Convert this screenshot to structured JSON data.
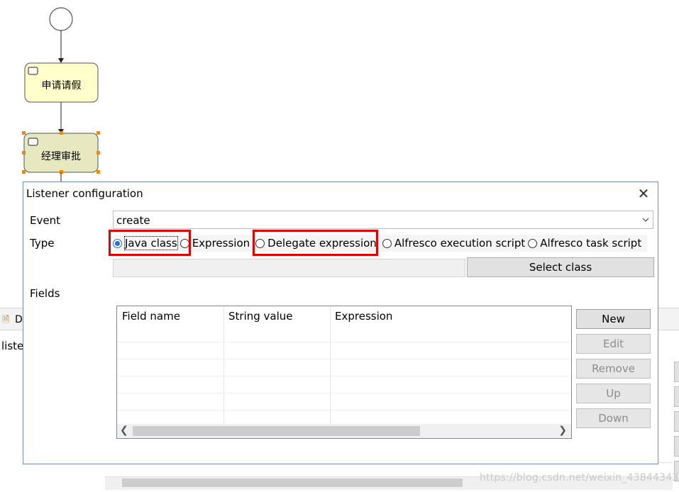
{
  "diagram": {
    "tasks": [
      {
        "label": "申请请假"
      },
      {
        "label": "经理审批"
      }
    ]
  },
  "background": {
    "tab_text": "D",
    "list_text": "liste",
    "watermark": "https://blog.csdn.net/weixin_43844343"
  },
  "dialog": {
    "title": "Listener configuration",
    "event_label": "Event",
    "event_value": "create",
    "type_label": "Type",
    "type_options": [
      {
        "label": "Java class",
        "checked": true
      },
      {
        "label": "Expression",
        "checked": false
      },
      {
        "label": "Delegate expression",
        "checked": false
      },
      {
        "label": "Alfresco execution script",
        "checked": false
      },
      {
        "label": "Alfresco task script",
        "checked": false
      }
    ],
    "select_class_label": "Select class",
    "fields_label": "Fields",
    "table": {
      "columns": [
        "Field name",
        "String value",
        "Expression"
      ]
    },
    "buttons": {
      "new": "New",
      "edit": "Edit",
      "remove": "Remove",
      "up": "Up",
      "down": "Down"
    }
  },
  "colors": {
    "accent": "#1e72d6",
    "highlight": "#e00000",
    "task_fill_1": "#ffffcc",
    "task_fill_2": "#e8e8c0",
    "selection_handle": "#f08a00"
  }
}
